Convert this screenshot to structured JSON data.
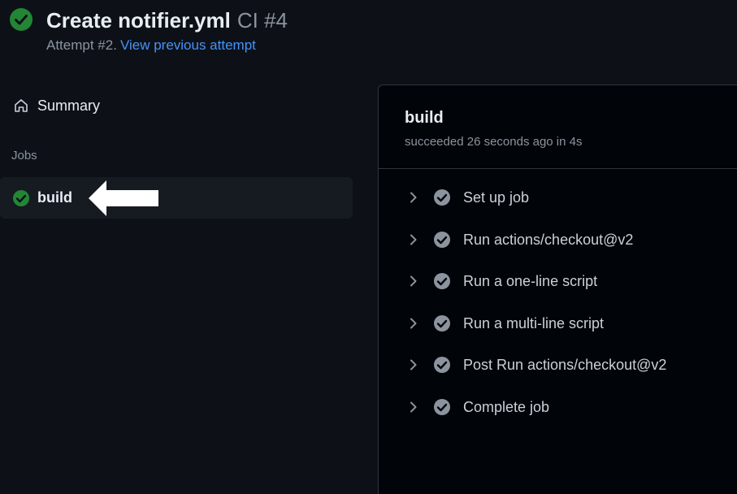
{
  "header": {
    "title": "Create notifier.yml",
    "workflow": "CI #4",
    "attempt_text": "Attempt #2.",
    "previous_attempt_link": "View previous attempt"
  },
  "sidebar": {
    "summary_label": "Summary",
    "jobs_heading": "Jobs",
    "jobs": [
      {
        "label": "build",
        "status": "success"
      }
    ]
  },
  "job": {
    "title": "build",
    "meta": "succeeded 26 seconds ago in 4s",
    "steps": [
      {
        "label": "Set up job",
        "status": "success"
      },
      {
        "label": "Run actions/checkout@v2",
        "status": "success"
      },
      {
        "label": "Run a one-line script",
        "status": "success"
      },
      {
        "label": "Run a multi-line script",
        "status": "success"
      },
      {
        "label": "Post Run actions/checkout@v2",
        "status": "success"
      },
      {
        "label": "Complete job",
        "status": "success"
      }
    ]
  },
  "colors": {
    "success_green": "#238636",
    "step_check_gray": "#8b949e",
    "link_blue": "#4493f8",
    "background": "#0d1117"
  },
  "icons": {
    "header_status": "check-circle-fill-icon",
    "summary": "home-icon",
    "job_status": "check-circle-fill-icon",
    "step_expand": "chevron-right-icon",
    "step_status": "check-circle-fill-icon",
    "annotation": "arrow-left-icon"
  }
}
